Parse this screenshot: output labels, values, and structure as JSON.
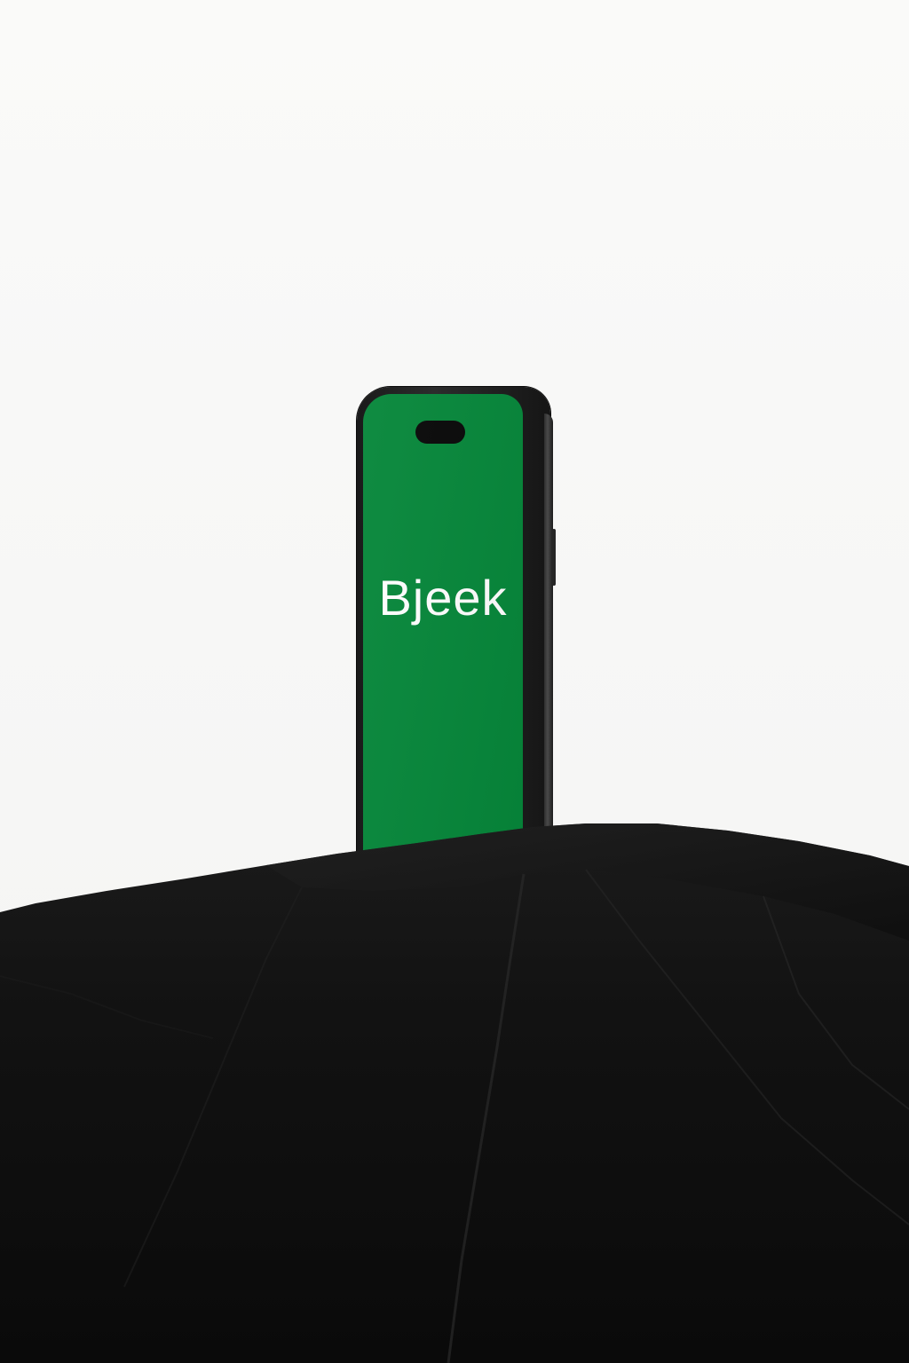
{
  "phone_screen": {
    "logo_text": "Bjeek",
    "background_color": "#06873a",
    "text_color": "#ffffff"
  },
  "scene": {
    "background_color": "#f8f8f7",
    "rock_color": "#111111"
  }
}
